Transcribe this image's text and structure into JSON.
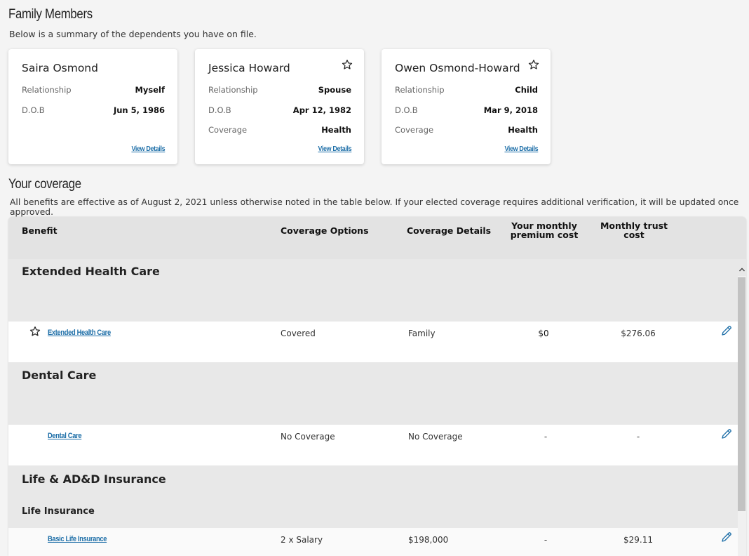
{
  "family": {
    "title": "Family Members",
    "subtitle": "Below is a summary of the dependents you have on file.",
    "labels": {
      "relationship": "Relationship",
      "dob": "D.O.B",
      "coverage": "Coverage",
      "view_details": "View Details"
    },
    "members": [
      {
        "name": "Saira Osmond",
        "relationship": "Myself",
        "dob": "Jun 5, 1986",
        "coverage": "",
        "starred": false
      },
      {
        "name": "Jessica Howard",
        "relationship": "Spouse",
        "dob": "Apr 12, 1982",
        "coverage": "Health",
        "starred": true
      },
      {
        "name": "Owen Osmond-Howard",
        "relationship": "Child",
        "dob": "Mar 9, 2018",
        "coverage": "Health",
        "starred": true
      }
    ]
  },
  "coverage": {
    "title": "Your coverage",
    "subtitle": "All benefits are effective as of August 2, 2021 unless otherwise noted in the table below. If your elected coverage requires additional verification, it will be updated once approved.",
    "columns": {
      "benefit": "Benefit",
      "options": "Coverage Options",
      "details": "Coverage Details",
      "premium_1": "Your monthly",
      "premium_2": "premium cost",
      "trust_1": "Monthly trust",
      "trust_2": "cost"
    },
    "groups": [
      {
        "title": "Extended Health Care",
        "subtitle": "",
        "row": {
          "benefit": "Extended Health Care",
          "options": "Covered",
          "details": "Family",
          "premium": "$0",
          "trust": "$276.06",
          "starred": true
        }
      },
      {
        "title": "Dental Care",
        "subtitle": "",
        "row": {
          "benefit": "Dental Care",
          "options": "No Coverage",
          "details": "No Coverage",
          "premium": "-",
          "trust": "-",
          "starred": false
        }
      },
      {
        "title": "Life & AD&D Insurance",
        "subtitle": "Life Insurance",
        "row": {
          "benefit": "Basic Life Insurance",
          "options": "2 x Salary",
          "details": "$198,000",
          "premium": "-",
          "trust": "$29.11",
          "starred": false
        }
      }
    ]
  },
  "colors": {
    "link": "#1e6fa8",
    "edit_icon": "#1e6fa8",
    "header_bg": "#e3e3e3",
    "group_bg": "#e8e8e8"
  }
}
